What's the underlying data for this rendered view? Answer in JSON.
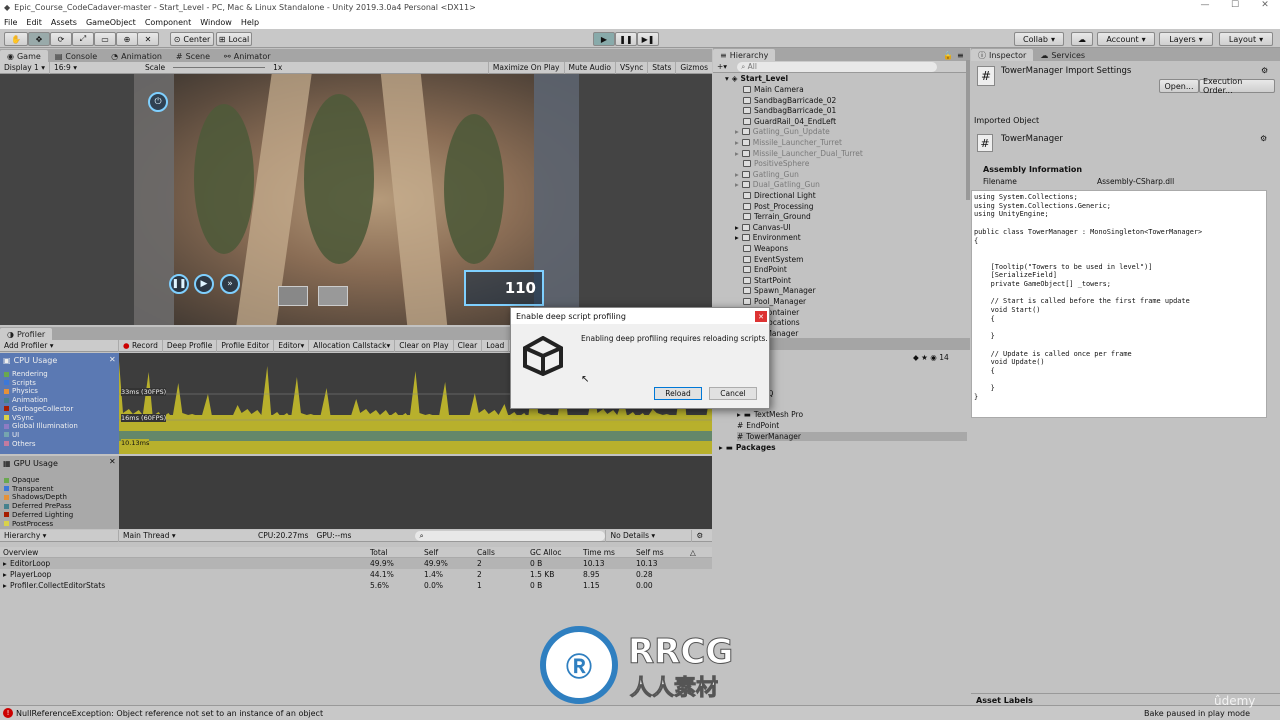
{
  "window": {
    "title": "Epic_Course_CodeCadaver-master - Start_Level - PC, Mac & Linux Standalone - Unity 2019.3.0a4 Personal <DX11>",
    "minimize": "—",
    "maximize": "☐",
    "close": "✕"
  },
  "menu": [
    "File",
    "Edit",
    "Assets",
    "GameObject",
    "Component",
    "Window",
    "Help"
  ],
  "toolbar": {
    "center": "Center",
    "local": "Local",
    "collab": "Collab",
    "account": "Account",
    "layers": "Layers",
    "layout": "Layout"
  },
  "game": {
    "tabs": [
      "Game",
      "Console",
      "Animation",
      "Scene",
      "Animator"
    ],
    "display": "Display 1",
    "aspect": "16:9",
    "scale_label": "Scale",
    "scale_value": "1x",
    "options": [
      "Maximize On Play",
      "Mute Audio",
      "VSync",
      "Stats",
      "Gizmos"
    ],
    "hud_score": "110"
  },
  "profiler": {
    "tab": "Profiler",
    "add": "Add Profiler",
    "controls": [
      "Record",
      "Deep Profile",
      "Profile Editor",
      "Editor",
      "Allocation Callstack",
      "Clear on Play",
      "Clear",
      "Load",
      "S"
    ],
    "cpu_title": "CPU Usage",
    "cpu_legend": [
      {
        "label": "Rendering",
        "color": "#6aa84f"
      },
      {
        "label": "Scripts",
        "color": "#3c78d8"
      },
      {
        "label": "Physics",
        "color": "#e69138"
      },
      {
        "label": "Animation",
        "color": "#45818e"
      },
      {
        "label": "GarbageCollector",
        "color": "#a61c00"
      },
      {
        "label": "VSync",
        "color": "#d9d24a"
      },
      {
        "label": "Global Illumination",
        "color": "#8e7cc3"
      },
      {
        "label": "UI",
        "color": "#76a5af"
      },
      {
        "label": "Others",
        "color": "#c27ba0"
      }
    ],
    "fps33": "33ms (30FPS)",
    "fps16": "16ms (60FPS)",
    "current": "10.13ms",
    "gpu_title": "GPU Usage",
    "gpu_legend": [
      {
        "label": "Opaque",
        "color": "#6aa84f"
      },
      {
        "label": "Transparent",
        "color": "#3c78d8"
      },
      {
        "label": "Shadows/Depth",
        "color": "#e69138"
      },
      {
        "label": "Deferred PrePass",
        "color": "#45818e"
      },
      {
        "label": "Deferred Lighting",
        "color": "#a61c00"
      },
      {
        "label": "PostProcess",
        "color": "#d9d24a"
      }
    ],
    "view": "Hierarchy",
    "thread": "Main Thread",
    "cpu_time": "CPU:20.27ms",
    "gpu_time": "GPU:--ms",
    "details": "No Details",
    "columns": [
      "Overview",
      "Total",
      "Self",
      "Calls",
      "GC Alloc",
      "Time ms",
      "Self ms"
    ],
    "rows": [
      [
        "EditorLoop",
        "49.9%",
        "49.9%",
        "2",
        "0 B",
        "10.13",
        "10.13"
      ],
      [
        "PlayerLoop",
        "44.1%",
        "1.4%",
        "2",
        "1.5 KB",
        "8.95",
        "0.28"
      ],
      [
        "Profiler.CollectEditorStats",
        "5.6%",
        "0.0%",
        "1",
        "0 B",
        "1.15",
        "0.00"
      ]
    ]
  },
  "hierarchy": {
    "tab": "Hierarchy",
    "search": "All",
    "scene": "Start_Level",
    "items": [
      "Main Camera",
      "SandbagBarricade_02",
      "SandbagBarricade_01",
      "GuardRail_04_EndLeft",
      "Gatling_Gun_Update",
      "Missile_Launcher_Turret",
      "Missile_Launcher_Dual_Turret",
      "PositiveSphere",
      "Gatling_Gun",
      "Dual_Gatling_Gun",
      "Directional Light",
      "Post_Processing",
      "Terrain_Ground",
      "Canvas-UI",
      "Environment",
      "Weapons",
      "EventSystem",
      "EndPoint",
      "StartPoint",
      "Spawn_Manager",
      "Pool_Manager",
      "h_Container",
      "er Locations",
      "er_Manager"
    ],
    "project_count": "14",
    "project_items": [
      "tions",
      "DevHQ",
      "s",
      "TextMesh Pro",
      "EndPoint",
      "TowerManager",
      "Packages"
    ]
  },
  "inspector": {
    "tabs": [
      "Inspector",
      "Services"
    ],
    "title": "TowerManager Import Settings",
    "open": "Open...",
    "exec_order": "Execution Order...",
    "imported": "Imported Object",
    "obj_name": "TowerManager",
    "assembly_info": "Assembly Information",
    "filename_label": "Filename",
    "filename": "Assembly-CSharp.dll",
    "code": "using System.Collections;\nusing System.Collections.Generic;\nusing UnityEngine;\n\npublic class TowerManager : MonoSingleton<TowerManager>\n{\n\n\n    [Tooltip(\"Towers to be used in level\")]\n    [SerializeField]\n    private GameObject[] _towers;\n\n    // Start is called before the first frame update\n    void Start()\n    {\n\n    }\n\n    // Update is called once per frame\n    void Update()\n    {\n\n    }\n}",
    "asset_labels": "Asset Labels"
  },
  "dialog": {
    "title": "Enable deep script profiling",
    "message": "Enabling deep profiling requires reloading scripts.",
    "reload": "Reload",
    "cancel": "Cancel"
  },
  "status": {
    "error": "NullReferenceException: Object reference not set to an instance of an object",
    "bake": "Bake paused in play mode"
  },
  "watermark": {
    "brand": "RRCG",
    "sub": "人人素材",
    "udemy": "ûdemy"
  }
}
